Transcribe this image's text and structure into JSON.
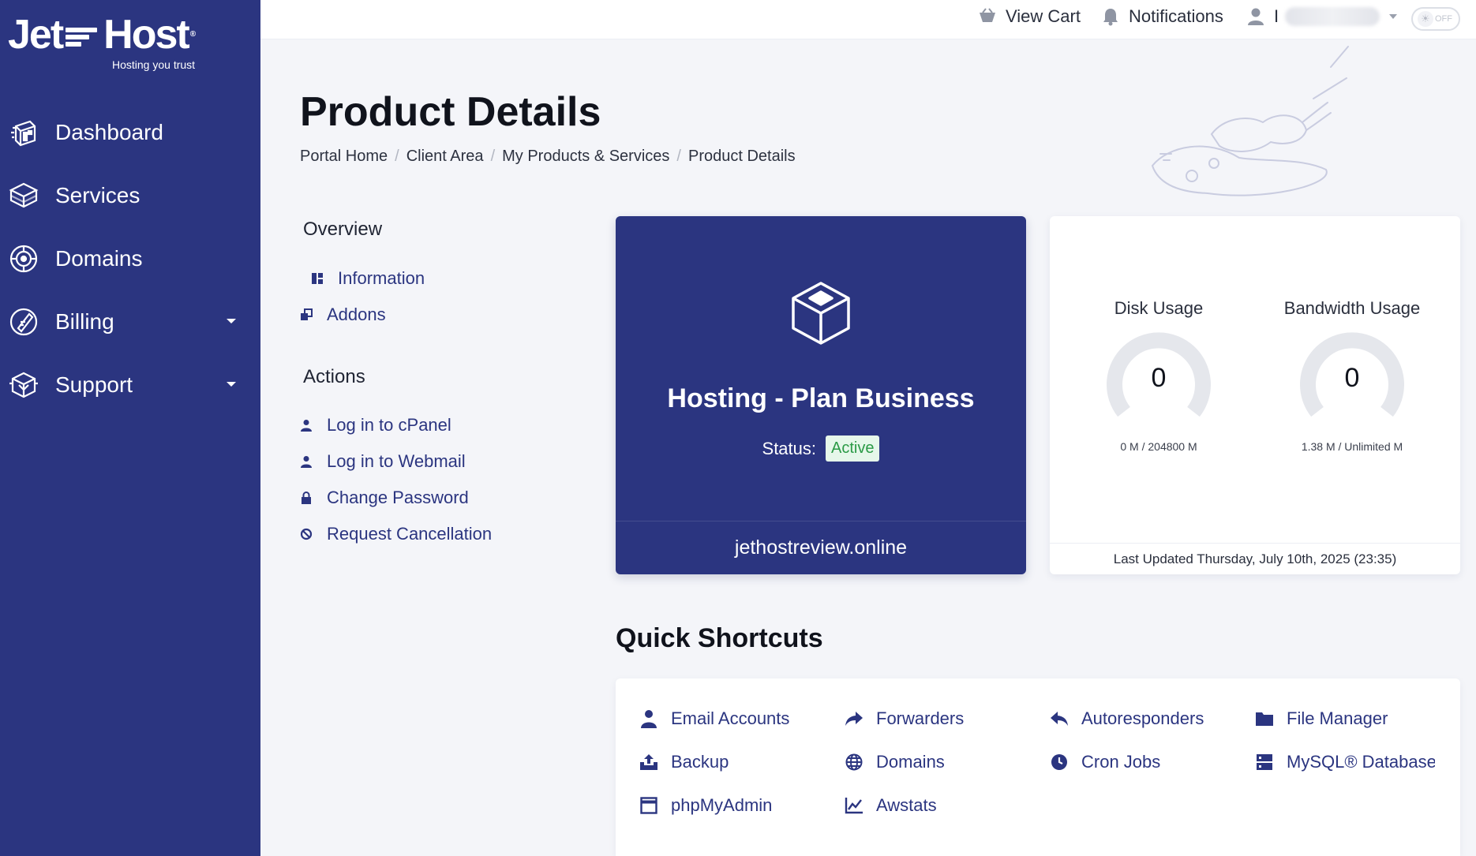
{
  "brand": {
    "name_left": "Jet",
    "name_right": "Host",
    "registered": "®",
    "tagline": "Hosting you trust"
  },
  "sidebar": {
    "items": [
      {
        "label": "Dashboard",
        "icon": "dashboard-icon"
      },
      {
        "label": "Services",
        "icon": "services-box-icon"
      },
      {
        "label": "Domains",
        "icon": "globe-icon"
      },
      {
        "label": "Billing",
        "icon": "billing-icon",
        "has_submenu": true
      },
      {
        "label": "Support",
        "icon": "support-icon",
        "has_submenu": true
      }
    ]
  },
  "topbar": {
    "cart_label": "View Cart",
    "notifications_label": "Notifications",
    "user_initial": "I",
    "toggle_label": "OFF"
  },
  "header": {
    "title": "Product Details",
    "breadcrumb": [
      "Portal Home",
      "Client Area",
      "My Products & Services",
      "Product Details"
    ],
    "separator": "/"
  },
  "overview": {
    "title": "Overview",
    "links": [
      {
        "label": "Information",
        "icon": "info-grid-icon"
      },
      {
        "label": "Addons",
        "icon": "addons-icon"
      }
    ]
  },
  "actions": {
    "title": "Actions",
    "links": [
      {
        "label": "Log in to cPanel",
        "icon": "user-icon"
      },
      {
        "label": "Log in to Webmail",
        "icon": "user-icon"
      },
      {
        "label": "Change Password",
        "icon": "lock-icon"
      },
      {
        "label": "Request Cancellation",
        "icon": "ban-icon"
      }
    ]
  },
  "product": {
    "name": "Hosting - Plan Business",
    "status_label": "Status:",
    "status_value": "Active",
    "domain": "jethostreview.online"
  },
  "usage": {
    "disk": {
      "title": "Disk Usage",
      "value": "0",
      "meta": "0 M / 204800 M",
      "fraction": 0
    },
    "bandwidth": {
      "title": "Bandwidth Usage",
      "value": "0",
      "meta": "1.38 M / Unlimited M",
      "fraction": 0
    },
    "last_updated": "Last Updated Thursday, July 10th, 2025 (23:35)"
  },
  "shortcuts": {
    "title": "Quick Shortcuts",
    "items": [
      {
        "label": "Email Accounts",
        "icon": "user-icon"
      },
      {
        "label": "Forwarders",
        "icon": "forward-arrow-icon"
      },
      {
        "label": "Autoresponders",
        "icon": "reply-arrow-icon"
      },
      {
        "label": "File Manager",
        "icon": "folder-icon"
      },
      {
        "label": "Backup",
        "icon": "upload-tray-icon"
      },
      {
        "label": "Domains",
        "icon": "globe-icon"
      },
      {
        "label": "Cron Jobs",
        "icon": "clock-icon"
      },
      {
        "label": "MySQL® Databases",
        "icon": "database-icon"
      },
      {
        "label": "phpMyAdmin",
        "icon": "window-icon"
      },
      {
        "label": "Awstats",
        "icon": "line-chart-icon"
      }
    ]
  },
  "colors": {
    "sidebar": "#2b3580",
    "accent": "#2b3580",
    "status_active_bg": "#e6f7ea",
    "status_active_text": "#2b9a46",
    "page_bg": "#f4f5f9"
  }
}
